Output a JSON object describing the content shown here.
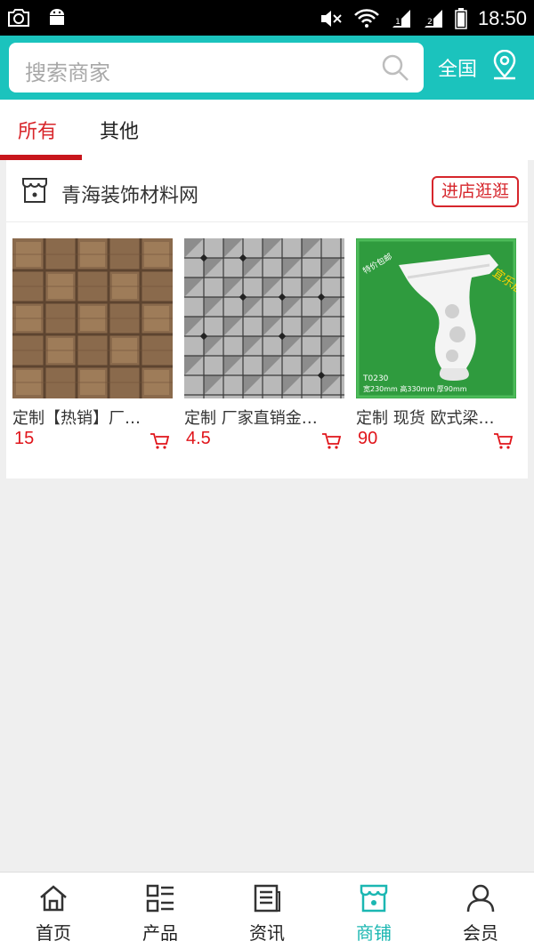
{
  "status_bar": {
    "time": "18:50"
  },
  "header": {
    "search_placeholder": "搜索商家",
    "region": "全国"
  },
  "tabs": [
    {
      "label": "所有",
      "active": true
    },
    {
      "label": "其他",
      "active": false
    }
  ],
  "shop": {
    "name": "青海装饰材料网",
    "enter_label": "进店逛逛",
    "products": [
      {
        "title": "定制【热销】厂…",
        "price": "15"
      },
      {
        "title": "定制 厂家直销金…",
        "price": "4.5"
      },
      {
        "title": "定制 现货 欧式梁…",
        "price": "90",
        "image_text": {
          "brand": "宜乐居",
          "tag": "特价包邮",
          "model": "T0230",
          "specs": "宽230mm 高330mm 厚90mm"
        }
      }
    ]
  },
  "bottom_nav": [
    {
      "label": "首页",
      "icon": "home-icon",
      "active": false
    },
    {
      "label": "产品",
      "icon": "list-icon",
      "active": false
    },
    {
      "label": "资讯",
      "icon": "news-icon",
      "active": false
    },
    {
      "label": "商铺",
      "icon": "store-icon",
      "active": true
    },
    {
      "label": "会员",
      "icon": "user-icon",
      "active": false
    }
  ],
  "colors": {
    "accent": "#1bc3bd",
    "red": "#d6262c",
    "price": "#e0141a"
  }
}
